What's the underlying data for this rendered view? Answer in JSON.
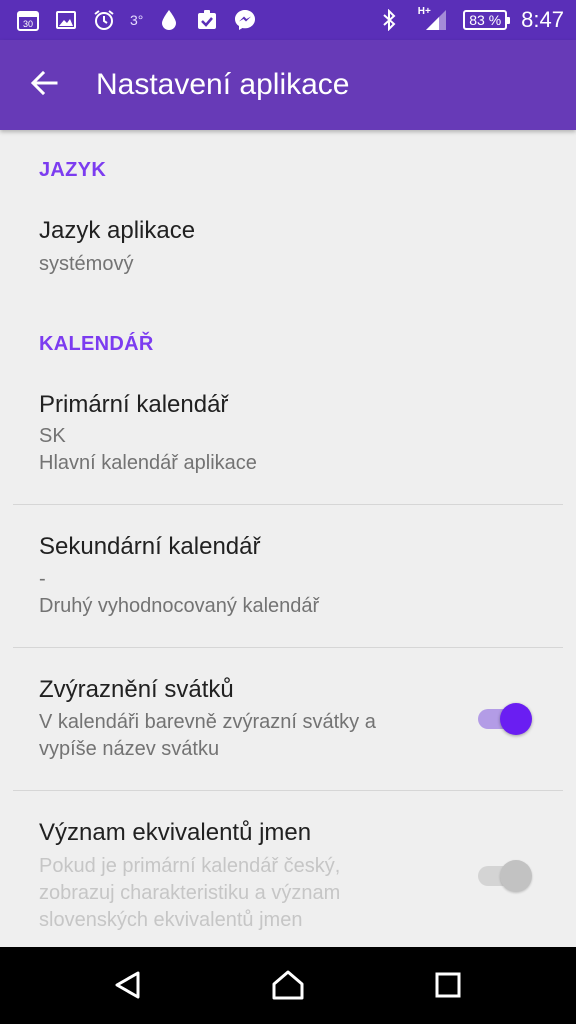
{
  "status_bar": {
    "temperature": "3°",
    "battery": "83 %",
    "network": "H+",
    "time": "8:47"
  },
  "app_bar": {
    "title": "Nastavení aplikace"
  },
  "sections": {
    "language": {
      "header": "JAZYK",
      "app_language": {
        "title": "Jazyk aplikace",
        "value": "systémový"
      }
    },
    "calendar": {
      "header": "KALENDÁŘ",
      "primary": {
        "title": "Primární kalendář",
        "value": "SK",
        "description": "Hlavní kalendář aplikace"
      },
      "secondary": {
        "title": "Sekundární kalendář",
        "value": "-",
        "description": "Druhý vyhodnocovaný kalendář"
      },
      "highlight_holidays": {
        "title": "Zvýraznění svátků",
        "description_line1": "V kalendáři barevně zvýrazní svátky a",
        "description_line2": "vypíše název svátku",
        "enabled": true
      },
      "name_equivalents": {
        "title": "Význam ekvivalentů jmen",
        "description_line1": "Pokud je primární kalendář český,",
        "description_line2": "zobrazuj charakteristiku a význam",
        "description_line3": "slovenských ekvivalentů jmen",
        "enabled": false,
        "disabled": true
      }
    }
  },
  "colors": {
    "status_bar": "#5a2fb8",
    "app_bar": "#673ab7",
    "accent": "#7c3cf0",
    "switch_on": "#6a1ef2"
  }
}
